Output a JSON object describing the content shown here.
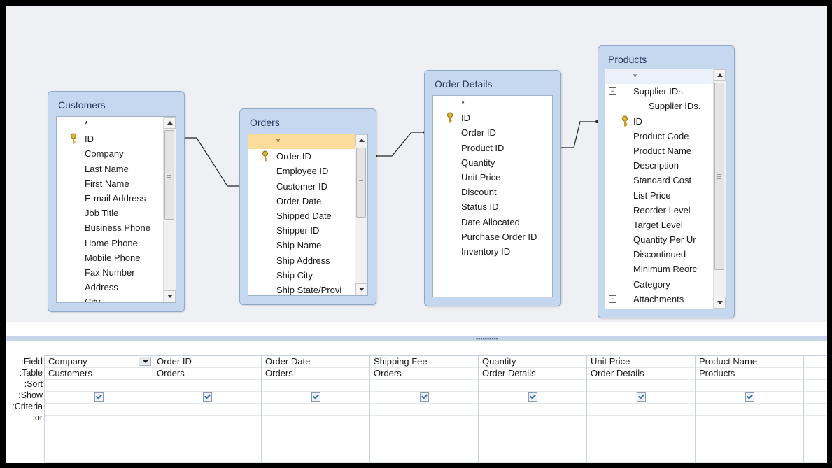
{
  "tables": {
    "customers": {
      "title": "Customers",
      "fields": [
        "*",
        "ID",
        "Company",
        "Last Name",
        "First Name",
        "E-mail Address",
        "Job Title",
        "Business Phone",
        "Home Phone",
        "Mobile Phone",
        "Fax Number",
        "Address",
        "City"
      ]
    },
    "orders": {
      "title": "Orders",
      "fields": [
        "*",
        "Order ID",
        "Employee ID",
        "Customer ID",
        "Order Date",
        "Shipped Date",
        "Shipper ID",
        "Ship Name",
        "Ship Address",
        "Ship City",
        "Ship State/Provi"
      ]
    },
    "order_details": {
      "title": "Order Details",
      "fields": [
        "*",
        "ID",
        "Order ID",
        "Product ID",
        "Quantity",
        "Unit Price",
        "Discount",
        "Status ID",
        "Date Allocated",
        "Purchase Order ID",
        "Inventory ID"
      ]
    },
    "products": {
      "title": "Products",
      "fields": [
        "*",
        "Supplier IDs",
        "Supplier IDs.",
        "ID",
        "Product Code",
        "Product Name",
        "Description",
        "Standard Cost",
        "List Price",
        "Reorder Level",
        "Target Level",
        "Quantity Per Ur",
        "Discontinued",
        "Minimum Reorc",
        "Category",
        "Attachments"
      ]
    }
  },
  "grid": {
    "row_labels": [
      "Field:",
      "Table:",
      "Sort:",
      "Show:",
      "Criteria:",
      "or:"
    ],
    "columns": [
      {
        "field": "Company",
        "table": "Customers",
        "show": true
      },
      {
        "field": "Order ID",
        "table": "Orders",
        "show": true
      },
      {
        "field": "Order Date",
        "table": "Orders",
        "show": true
      },
      {
        "field": "Shipping Fee",
        "table": "Orders",
        "show": true
      },
      {
        "field": "Quantity",
        "table": "Order Details",
        "show": true
      },
      {
        "field": "Unit Price",
        "table": "Order Details",
        "show": true
      },
      {
        "field": "Product Name",
        "table": "Products",
        "show": true
      }
    ]
  },
  "colors": {
    "table_header": "#c6d8ef",
    "selected_field": "#fbdc9a",
    "canvas": "#eef0f4"
  }
}
